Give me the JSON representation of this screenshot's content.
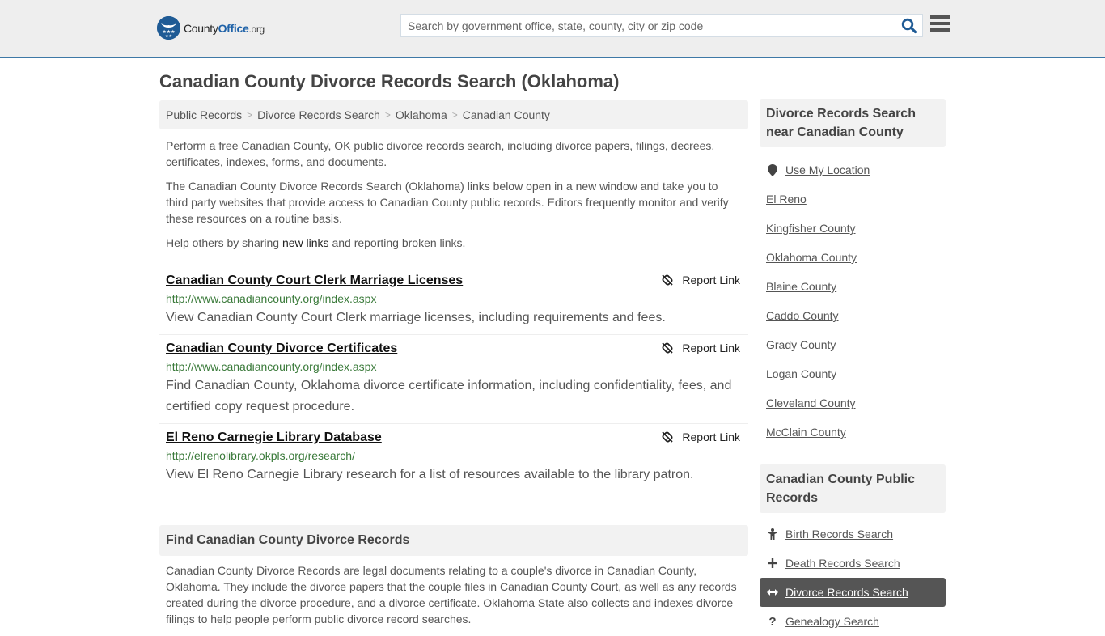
{
  "header": {
    "logo": {
      "prefix": "County",
      "bold": "Office",
      "suffix": ".org",
      "icon": "eagle-stars-badge"
    },
    "search_placeholder": "Search by government office, state, county, city or zip code",
    "search_value": "",
    "search_icon": "search-icon",
    "menu_icon": "hamburger-menu-icon",
    "accent_color": "#3d78a6"
  },
  "page": {
    "title": "Canadian County Divorce Records Search (Oklahoma)"
  },
  "breadcrumb": [
    {
      "label": "Public Records"
    },
    {
      "label": "Divorce Records Search"
    },
    {
      "label": "Oklahoma"
    },
    {
      "label": "Canadian County"
    }
  ],
  "breadcrumb_separator": ">",
  "intro": {
    "p1": "Perform a free Canadian County, OK public divorce records search, including divorce papers, filings, decrees, certificates, indexes, forms, and documents.",
    "p2": "The Canadian County Divorce Records Search (Oklahoma) links below open in a new window and take you to third party websites that provide access to Canadian County public records. Editors frequently monitor and verify these resources on a routine basis.",
    "p3_before": "Help others by sharing ",
    "p3_link": "new links",
    "p3_after": " and reporting broken links."
  },
  "links": [
    {
      "title": "Canadian County Court Clerk Marriage Licenses",
      "url": "http://www.canadiancounty.org/index.aspx",
      "description": "View Canadian County Court Clerk marriage licenses, including requirements and fees.",
      "report_label": "Report Link"
    },
    {
      "title": "Canadian County Divorce Certificates",
      "url": "http://www.canadiancounty.org/index.aspx",
      "description": "Find Canadian County, Oklahoma divorce certificate information, including confidentiality, fees, and certified copy request procedure.",
      "report_label": "Report Link"
    },
    {
      "title": "El Reno Carnegie Library Database",
      "url": "http://elrenolibrary.okpls.org/research/",
      "description": "View El Reno Carnegie Library research for a list of resources available to the library patron.",
      "report_label": "Report Link"
    }
  ],
  "find_section": {
    "heading": "Find Canadian County Divorce Records",
    "body": "Canadian County Divorce Records are legal documents relating to a couple's divorce in Canadian County, Oklahoma. They include the divorce papers that the couple files in Canadian County Court, as well as any records created during the divorce procedure, and a divorce certificate. Oklahoma State also collects and indexes divorce filings to help people perform public divorce record searches."
  },
  "sidebar": {
    "nearby": {
      "heading": "Divorce Records Search near Canadian County",
      "use_location": "Use My Location",
      "items": [
        "El Reno",
        "Kingfisher County",
        "Oklahoma County",
        "Blaine County",
        "Caddo County",
        "Grady County",
        "Logan County",
        "Cleveland County",
        "McClain County"
      ]
    },
    "public_records": {
      "heading": "Canadian County Public Records",
      "items": [
        {
          "label": "Birth Records Search",
          "icon": "child-icon",
          "active": false
        },
        {
          "label": "Death Records Search",
          "icon": "plus-cross-icon",
          "active": false
        },
        {
          "label": "Divorce Records Search",
          "icon": "left-right-arrow-icon",
          "active": true
        },
        {
          "label": "Genealogy Search",
          "icon": "question-icon",
          "active": false
        }
      ]
    }
  }
}
